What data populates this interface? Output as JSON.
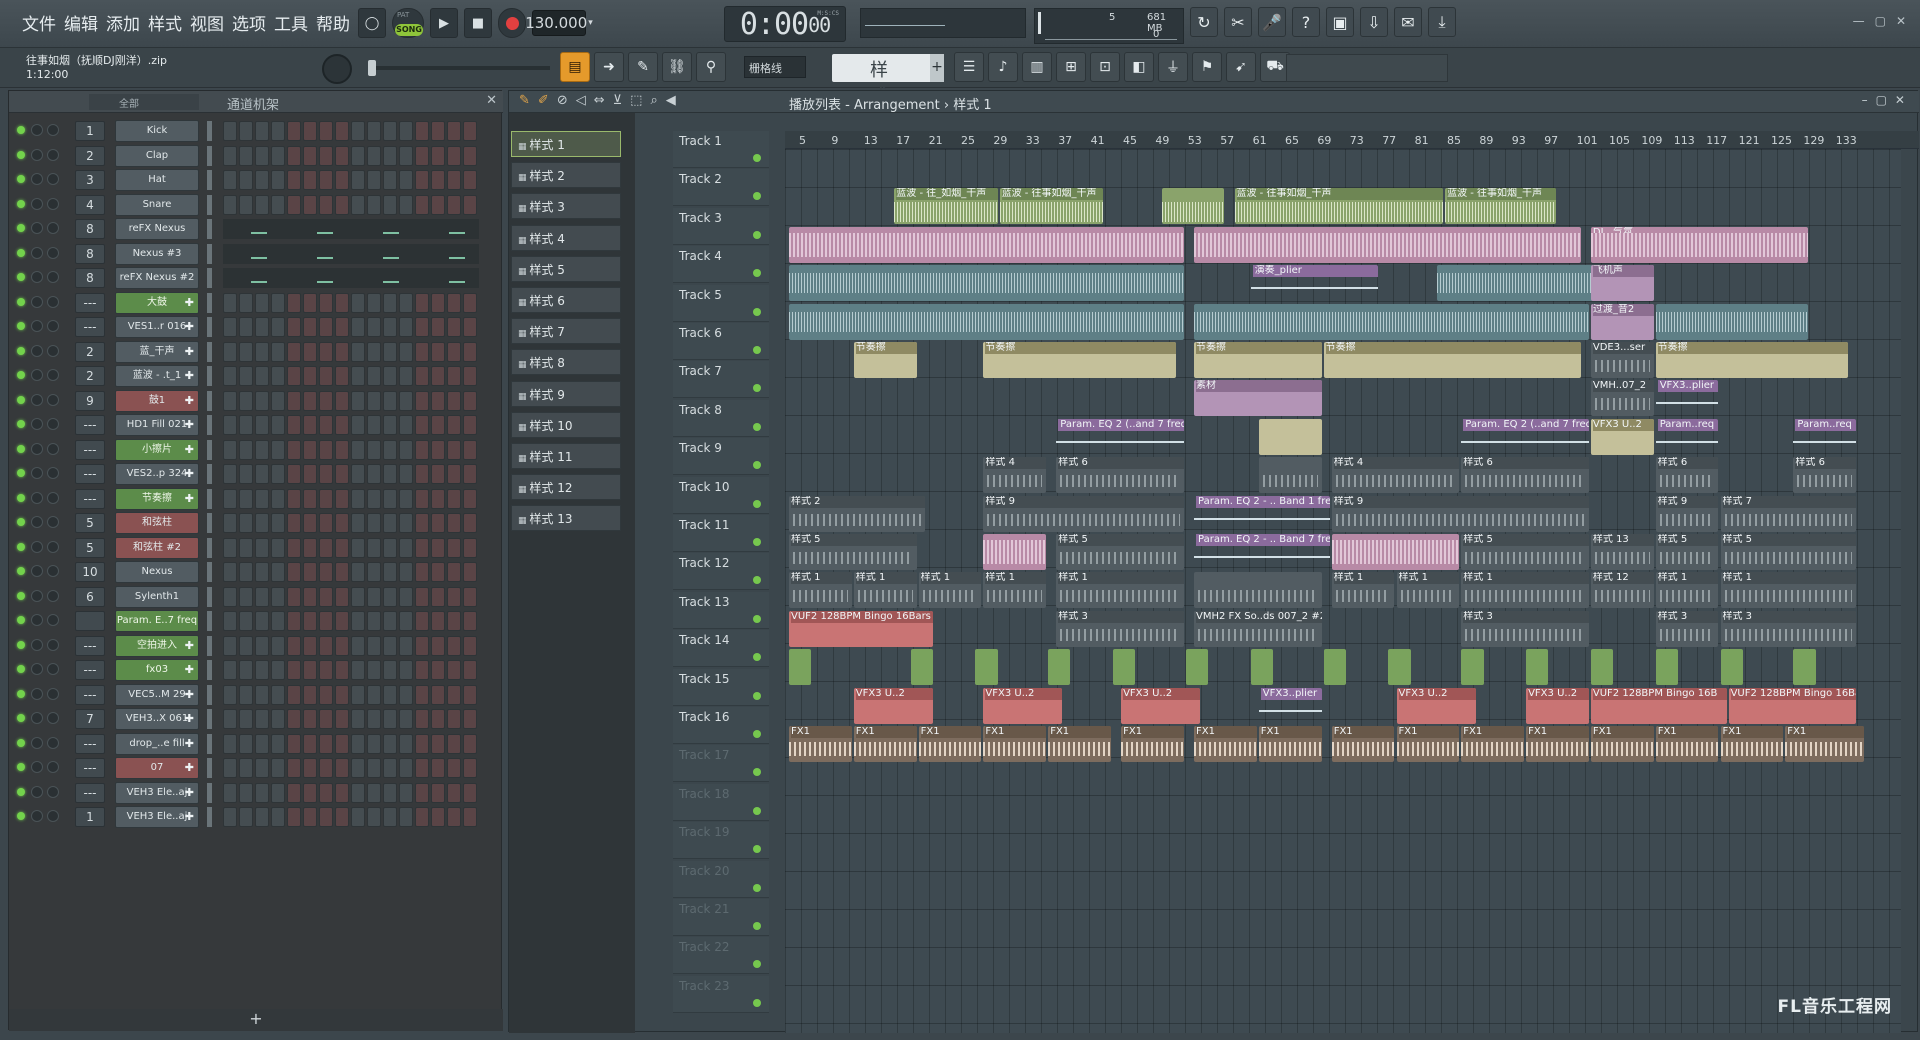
{
  "menu": [
    "文件",
    "编辑",
    "添加",
    "样式",
    "视图",
    "选项",
    "工具",
    "帮助"
  ],
  "transport": {
    "song_label": "SONG",
    "pat_label": "PAT",
    "tempo": "130.000",
    "clock": "0:00",
    "clock_small": "00",
    "clock_unit": "M:S:CS"
  },
  "meter": {
    "cpu": "5",
    "mem": "681 MB",
    "poly": "0"
  },
  "project": {
    "title": "往事如烟（抚顺DJ刚洋）.zip",
    "time": "1:12:00"
  },
  "toolbar2": {
    "snap": "栅格线",
    "pattern": "样式 1"
  },
  "rack": {
    "filter": "全部",
    "title": "通道机架",
    "add": "+",
    "channels": [
      {
        "num": "1",
        "name": "Kick",
        "style": ""
      },
      {
        "num": "2",
        "name": "Clap",
        "style": ""
      },
      {
        "num": "3",
        "name": "Hat",
        "style": ""
      },
      {
        "num": "4",
        "name": "Snare",
        "style": ""
      },
      {
        "num": "8",
        "name": "reFX Nexus",
        "style": ""
      },
      {
        "num": "8",
        "name": "Nexus #3",
        "style": ""
      },
      {
        "num": "8",
        "name": "reFX Nexus #2",
        "style": ""
      },
      {
        "num": "---",
        "name": "大鼓",
        "style": "green plus"
      },
      {
        "num": "---",
        "name": "VES1..r 016",
        "style": "plus"
      },
      {
        "num": "2",
        "name": "蓝_干声",
        "style": "plus"
      },
      {
        "num": "2",
        "name": "蓝波 - .t_1",
        "style": "plus"
      },
      {
        "num": "9",
        "name": "鼓1",
        "style": "red plus"
      },
      {
        "num": "---",
        "name": "HD1 Fill 021",
        "style": "plus"
      },
      {
        "num": "---",
        "name": "小擦片",
        "style": "green plus"
      },
      {
        "num": "---",
        "name": "VES2..p 324",
        "style": "plus"
      },
      {
        "num": "---",
        "name": "节奏擦",
        "style": "green plus"
      },
      {
        "num": "5",
        "name": "和弦柱",
        "style": "red"
      },
      {
        "num": "5",
        "name": "和弦柱 #2",
        "style": "red"
      },
      {
        "num": "10",
        "name": "Nexus",
        "style": ""
      },
      {
        "num": "6",
        "name": "Sylenth1",
        "style": ""
      },
      {
        "num": "",
        "name": "Param. E..7 freq",
        "style": "green"
      },
      {
        "num": "---",
        "name": "空拍进入",
        "style": "green plus"
      },
      {
        "num": "---",
        "name": "fx03",
        "style": "green plus"
      },
      {
        "num": "---",
        "name": "VEC5..M 29",
        "style": "plus"
      },
      {
        "num": "7",
        "name": "VEH3..X 061",
        "style": "plus"
      },
      {
        "num": "---",
        "name": "drop_..e fill",
        "style": "plus"
      },
      {
        "num": "---",
        "name": "07",
        "style": "red plus"
      },
      {
        "num": "---",
        "name": "VEH3 Ele..aj",
        "style": "plus"
      },
      {
        "num": "1",
        "name": "VEH3 Ele..aj",
        "style": "plus"
      }
    ]
  },
  "playlist": {
    "title": "播放列表 - Arrangement › 样式 1",
    "patterns": [
      "样式 1",
      "样式 2",
      "样式 3",
      "样式 4",
      "样式 5",
      "样式 6",
      "样式 7",
      "样式 8",
      "样式 9",
      "样式 10",
      "样式 11",
      "样式 12",
      "样式 13"
    ],
    "tracks": [
      "Track 1",
      "Track 2",
      "Track 3",
      "Track 4",
      "Track 5",
      "Track 6",
      "Track 7",
      "Track 8",
      "Track 9",
      "Track 10",
      "Track 11",
      "Track 12",
      "Track 13",
      "Track 14",
      "Track 15",
      "Track 16",
      "Track 17",
      "Track 18",
      "Track 19",
      "Track 20",
      "Track 21",
      "Track 22",
      "Track 23"
    ],
    "bars": [
      "5",
      "9",
      "13",
      "17",
      "21",
      "25",
      "29",
      "33",
      "37",
      "41",
      "45",
      "49",
      "53",
      "57",
      "61",
      "65",
      "69",
      "73",
      "77",
      "81",
      "85",
      "89",
      "93",
      "97",
      "101",
      "105",
      "109",
      "113",
      "117",
      "121",
      "125",
      "129",
      "133"
    ],
    "clips": [
      {
        "t": 1,
        "s": 13,
        "w": 13,
        "k": "audio",
        "l": "蓝波 - 往_如烟_干声"
      },
      {
        "t": 1,
        "s": 26,
        "w": 13,
        "k": "audio",
        "l": "蓝波 - 往事如烟_干声"
      },
      {
        "t": 1,
        "s": 46,
        "w": 8,
        "k": "audio",
        "l": ""
      },
      {
        "t": 1,
        "s": 55,
        "w": 26,
        "k": "audio",
        "l": "蓝波 - 往事如烟_干声"
      },
      {
        "t": 1,
        "s": 81,
        "w": 14,
        "k": "audio",
        "l": "蓝波 - 往事如烟_干声"
      },
      {
        "t": 2,
        "s": 0,
        "w": 49,
        "k": "pink",
        "l": ""
      },
      {
        "t": 2,
        "s": 50,
        "w": 48,
        "k": "pink",
        "l": ""
      },
      {
        "t": 2,
        "s": 99,
        "w": 27,
        "k": "pink",
        "l": "DJ...气氛"
      },
      {
        "t": 3,
        "s": 0,
        "w": 49,
        "k": "teal",
        "l": ""
      },
      {
        "t": 3,
        "s": 57,
        "w": 16,
        "k": "auto",
        "l": "演奏_plier"
      },
      {
        "t": 3,
        "s": 80,
        "w": 20,
        "k": "teal",
        "l": ""
      },
      {
        "t": 3,
        "s": 99,
        "w": 8,
        "k": "mauve",
        "l": "飞机声"
      },
      {
        "t": 4,
        "s": 0,
        "w": 49,
        "k": "teal",
        "l": ""
      },
      {
        "t": 4,
        "s": 50,
        "w": 49,
        "k": "teal",
        "l": ""
      },
      {
        "t": 4,
        "s": 99,
        "w": 8,
        "k": "mauve",
        "l": "过渡_音2"
      },
      {
        "t": 4,
        "s": 107,
        "w": 19,
        "k": "teal",
        "l": ""
      },
      {
        "t": 5,
        "s": 8,
        "w": 8,
        "k": "sand",
        "l": "节奏擦"
      },
      {
        "t": 5,
        "s": 24,
        "w": 24,
        "k": "sand",
        "l": "节奏擦"
      },
      {
        "t": 5,
        "s": 50,
        "w": 16,
        "k": "sand",
        "l": "节奏擦"
      },
      {
        "t": 5,
        "s": 66,
        "w": 32,
        "k": "sand",
        "l": "节奏擦"
      },
      {
        "t": 5,
        "s": 99,
        "w": 8,
        "k": "pat",
        "l": "VDE3...ser"
      },
      {
        "t": 5,
        "s": 107,
        "w": 24,
        "k": "sand",
        "l": "节奏擦"
      },
      {
        "t": 6,
        "s": 50,
        "w": 16,
        "k": "mauve",
        "l": "素材"
      },
      {
        "t": 6,
        "s": 99,
        "w": 8,
        "k": "pat",
        "l": "VMH..07_2"
      },
      {
        "t": 6,
        "s": 107,
        "w": 8,
        "k": "auto",
        "l": "VFX3..plier"
      },
      {
        "t": 7,
        "s": 33,
        "w": 16,
        "k": "auto",
        "l": "Param. EQ 2 (..and 7 freq"
      },
      {
        "t": 7,
        "s": 58,
        "w": 8,
        "k": "sand",
        "l": ""
      },
      {
        "t": 7,
        "s": 83,
        "w": 16,
        "k": "auto",
        "l": "Param. EQ 2 (..and 7 freq"
      },
      {
        "t": 7,
        "s": 99,
        "w": 8,
        "k": "sand",
        "l": "VFX3 U..2"
      },
      {
        "t": 7,
        "s": 107,
        "w": 8,
        "k": "auto",
        "l": "Param..req"
      },
      {
        "t": 7,
        "s": 124,
        "w": 8,
        "k": "auto",
        "l": "Param..req"
      },
      {
        "t": 8,
        "s": 24,
        "w": 8,
        "k": "pat",
        "l": "样式 4"
      },
      {
        "t": 8,
        "s": 33,
        "w": 16,
        "k": "pat",
        "l": "样式 6"
      },
      {
        "t": 8,
        "s": 58,
        "w": 8,
        "k": "pat",
        "l": ""
      },
      {
        "t": 8,
        "s": 67,
        "w": 16,
        "k": "pat",
        "l": "样式 4"
      },
      {
        "t": 8,
        "s": 83,
        "w": 16,
        "k": "pat",
        "l": "样式 6"
      },
      {
        "t": 8,
        "s": 107,
        "w": 8,
        "k": "pat",
        "l": "样式 6"
      },
      {
        "t": 8,
        "s": 124,
        "w": 8,
        "k": "pat",
        "l": "样式 6"
      },
      {
        "t": 9,
        "s": 0,
        "w": 17,
        "k": "pat",
        "l": "样式 2"
      },
      {
        "t": 9,
        "s": 24,
        "w": 25,
        "k": "pat",
        "l": "样式 9"
      },
      {
        "t": 9,
        "s": 50,
        "w": 17,
        "k": "auto",
        "l": "Param. EQ 2 - .. Band 1 freq"
      },
      {
        "t": 9,
        "s": 67,
        "w": 32,
        "k": "pat",
        "l": "样式 9"
      },
      {
        "t": 9,
        "s": 107,
        "w": 8,
        "k": "pat",
        "l": "样式 9"
      },
      {
        "t": 9,
        "s": 115,
        "w": 17,
        "k": "pat",
        "l": "样式 7"
      },
      {
        "t": 10,
        "s": 0,
        "w": 16,
        "k": "pat",
        "l": "样式 5"
      },
      {
        "t": 10,
        "s": 24,
        "w": 8,
        "k": "pink",
        "l": ""
      },
      {
        "t": 10,
        "s": 33,
        "w": 16,
        "k": "pat",
        "l": "样式 5"
      },
      {
        "t": 10,
        "s": 50,
        "w": 17,
        "k": "auto",
        "l": "Param. EQ 2 - .. Band 7 freq"
      },
      {
        "t": 10,
        "s": 67,
        "w": 16,
        "k": "pink",
        "l": ""
      },
      {
        "t": 10,
        "s": 83,
        "w": 16,
        "k": "pat",
        "l": "样式 5"
      },
      {
        "t": 10,
        "s": 99,
        "w": 8,
        "k": "pat",
        "l": "样式 13"
      },
      {
        "t": 10,
        "s": 107,
        "w": 8,
        "k": "pat",
        "l": "样式 5"
      },
      {
        "t": 10,
        "s": 115,
        "w": 17,
        "k": "pat",
        "l": "样式 5"
      },
      {
        "t": 11,
        "s": 0,
        "w": 8,
        "k": "pat",
        "l": "样式 1"
      },
      {
        "t": 11,
        "s": 8,
        "w": 8,
        "k": "pat",
        "l": "样式 1"
      },
      {
        "t": 11,
        "s": 16,
        "w": 8,
        "k": "pat",
        "l": "样式 1"
      },
      {
        "t": 11,
        "s": 24,
        "w": 8,
        "k": "pat",
        "l": "样式 1"
      },
      {
        "t": 11,
        "s": 33,
        "w": 16,
        "k": "pat",
        "l": "样式 1"
      },
      {
        "t": 11,
        "s": 50,
        "w": 16,
        "k": "pat",
        "l": ""
      },
      {
        "t": 11,
        "s": 67,
        "w": 8,
        "k": "pat",
        "l": "样式 1"
      },
      {
        "t": 11,
        "s": 75,
        "w": 8,
        "k": "pat",
        "l": "样式 1"
      },
      {
        "t": 11,
        "s": 83,
        "w": 16,
        "k": "pat",
        "l": "样式 1"
      },
      {
        "t": 11,
        "s": 99,
        "w": 8,
        "k": "pat",
        "l": "样式 12"
      },
      {
        "t": 11,
        "s": 107,
        "w": 8,
        "k": "pat",
        "l": "样式 1"
      },
      {
        "t": 11,
        "s": 115,
        "w": 17,
        "k": "pat",
        "l": "样式 1"
      },
      {
        "t": 12,
        "s": 0,
        "w": 18,
        "k": "red",
        "l": "VUF2 128BPM Bingo 16Bars"
      },
      {
        "t": 12,
        "s": 33,
        "w": 16,
        "k": "pat",
        "l": "样式 3"
      },
      {
        "t": 12,
        "s": 50,
        "w": 16,
        "k": "pat",
        "l": "VMH2 FX So..ds 007_2 #2"
      },
      {
        "t": 12,
        "s": 83,
        "w": 16,
        "k": "pat",
        "l": "样式 3"
      },
      {
        "t": 12,
        "s": 107,
        "w": 8,
        "k": "pat",
        "l": "样式 3"
      },
      {
        "t": 12,
        "s": 115,
        "w": 17,
        "k": "pat",
        "l": "样式 3"
      },
      {
        "t": 13,
        "s": 0,
        "w": 3,
        "k": "green",
        "l": ""
      },
      {
        "t": 13,
        "s": 15,
        "w": 3,
        "k": "green",
        "l": ""
      },
      {
        "t": 13,
        "s": 23,
        "w": 3,
        "k": "green",
        "l": ""
      },
      {
        "t": 13,
        "s": 32,
        "w": 3,
        "k": "green",
        "l": ""
      },
      {
        "t": 13,
        "s": 40,
        "w": 3,
        "k": "green",
        "l": ""
      },
      {
        "t": 13,
        "s": 49,
        "w": 3,
        "k": "green",
        "l": ""
      },
      {
        "t": 13,
        "s": 57,
        "w": 3,
        "k": "green",
        "l": ""
      },
      {
        "t": 13,
        "s": 66,
        "w": 3,
        "k": "green",
        "l": ""
      },
      {
        "t": 13,
        "s": 74,
        "w": 3,
        "k": "green",
        "l": ""
      },
      {
        "t": 13,
        "s": 83,
        "w": 3,
        "k": "green",
        "l": ""
      },
      {
        "t": 13,
        "s": 91,
        "w": 3,
        "k": "green",
        "l": ""
      },
      {
        "t": 13,
        "s": 99,
        "w": 3,
        "k": "green",
        "l": ""
      },
      {
        "t": 13,
        "s": 107,
        "w": 3,
        "k": "green",
        "l": ""
      },
      {
        "t": 13,
        "s": 115,
        "w": 3,
        "k": "green",
        "l": ""
      },
      {
        "t": 13,
        "s": 124,
        "w": 3,
        "k": "green",
        "l": ""
      },
      {
        "t": 14,
        "s": 8,
        "w": 10,
        "k": "red",
        "l": "VFX3 U..2"
      },
      {
        "t": 14,
        "s": 24,
        "w": 10,
        "k": "red",
        "l": "VFX3 U..2"
      },
      {
        "t": 14,
        "s": 41,
        "w": 10,
        "k": "red",
        "l": "VFX3 U..2"
      },
      {
        "t": 14,
        "s": 58,
        "w": 8,
        "k": "auto",
        "l": "VFX3..plier"
      },
      {
        "t": 14,
        "s": 75,
        "w": 10,
        "k": "red",
        "l": "VFX3 U..2"
      },
      {
        "t": 14,
        "s": 91,
        "w": 8,
        "k": "red",
        "l": "VFX3 U..2"
      },
      {
        "t": 14,
        "s": 99,
        "w": 17,
        "k": "red",
        "l": "VUF2 128BPM Bingo 16B"
      },
      {
        "t": 14,
        "s": 116,
        "w": 16,
        "k": "red",
        "l": "VUF2 128BPM Bingo 16Bars"
      },
      {
        "t": 15,
        "s": 0,
        "w": 8,
        "k": "fx",
        "l": "FX1"
      },
      {
        "t": 15,
        "s": 8,
        "w": 8,
        "k": "fx",
        "l": "FX1"
      },
      {
        "t": 15,
        "s": 16,
        "w": 8,
        "k": "fx",
        "l": "FX1"
      },
      {
        "t": 15,
        "s": 24,
        "w": 8,
        "k": "fx",
        "l": "FX1"
      },
      {
        "t": 15,
        "s": 32,
        "w": 8,
        "k": "fx",
        "l": "FX1"
      },
      {
        "t": 15,
        "s": 41,
        "w": 8,
        "k": "fx",
        "l": "FX1"
      },
      {
        "t": 15,
        "s": 50,
        "w": 8,
        "k": "fx",
        "l": "FX1"
      },
      {
        "t": 15,
        "s": 58,
        "w": 8,
        "k": "fx",
        "l": "FX1"
      },
      {
        "t": 15,
        "s": 67,
        "w": 8,
        "k": "fx",
        "l": "FX1"
      },
      {
        "t": 15,
        "s": 75,
        "w": 8,
        "k": "fx",
        "l": "FX1"
      },
      {
        "t": 15,
        "s": 83,
        "w": 8,
        "k": "fx",
        "l": "FX1"
      },
      {
        "t": 15,
        "s": 91,
        "w": 8,
        "k": "fx",
        "l": "FX1"
      },
      {
        "t": 15,
        "s": 99,
        "w": 8,
        "k": "fx",
        "l": "FX1"
      },
      {
        "t": 15,
        "s": 107,
        "w": 8,
        "k": "fx",
        "l": "FX1"
      },
      {
        "t": 15,
        "s": 115,
        "w": 8,
        "k": "fx",
        "l": "FX1"
      },
      {
        "t": 15,
        "s": 123,
        "w": 10,
        "k": "fx",
        "l": "FX1"
      }
    ]
  },
  "watermark": "FL音乐工程网"
}
